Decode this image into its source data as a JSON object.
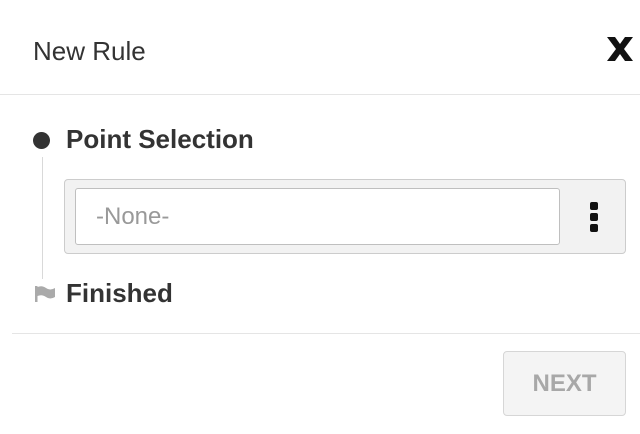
{
  "dialog": {
    "title": "New Rule",
    "close_icon": "close-icon"
  },
  "steps": [
    {
      "label": "Point Selection",
      "marker_icon": "filled-circle-icon",
      "field": {
        "value": "-None-",
        "menu_icon": "vertical-ellipsis-icon"
      }
    },
    {
      "label": "Finished",
      "marker_icon": "flag-icon"
    }
  ],
  "footer": {
    "next_label": "NEXT",
    "next_enabled": false
  },
  "colors": {
    "text": "#333333",
    "placeholder": "#999999",
    "disabled_button_text": "#a8a8a8",
    "divider": "#e5e5e5"
  }
}
